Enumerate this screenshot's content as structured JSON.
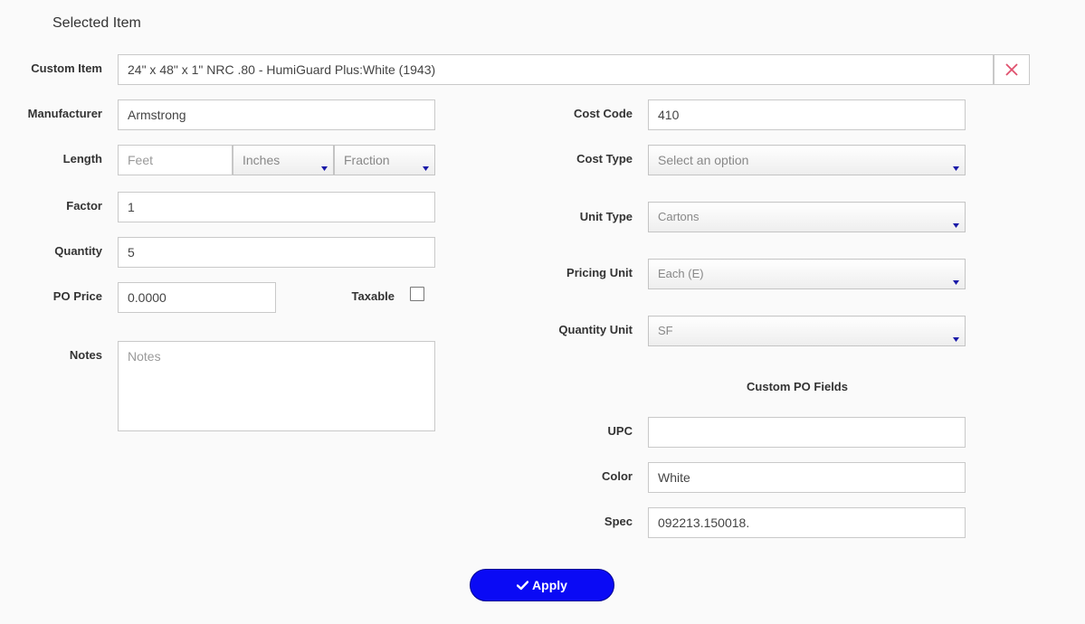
{
  "header": {
    "title": "Selected Item"
  },
  "custom_item": {
    "label": "Custom Item",
    "value": "24\" x 48\" x 1\" NRC .80 - HumiGuard Plus:White (1943)",
    "clear_icon": "close-icon",
    "clear_color": "#e0506e"
  },
  "manufacturer": {
    "label": "Manufacturer",
    "value": "Armstrong"
  },
  "length": {
    "label": "Length",
    "feet_placeholder": "Feet",
    "inches_value": "Inches",
    "fraction_value": "Fraction"
  },
  "factor": {
    "label": "Factor",
    "value": "1"
  },
  "quantity": {
    "label": "Quantity",
    "value": "5"
  },
  "po_price": {
    "label": "PO Price",
    "value": "0.0000"
  },
  "taxable": {
    "label": "Taxable",
    "checked": false
  },
  "notes": {
    "label": "Notes",
    "placeholder": "Notes"
  },
  "cost_code": {
    "label": "Cost Code",
    "value": "410"
  },
  "cost_type": {
    "label": "Cost Type",
    "value": "Select an option"
  },
  "unit_type": {
    "label": "Unit Type",
    "value": "Cartons"
  },
  "pricing_unit": {
    "label": "Pricing Unit",
    "value": "Each (E)"
  },
  "quantity_unit": {
    "label": "Quantity Unit",
    "value": "SF"
  },
  "custom_po": {
    "title": "Custom PO Fields",
    "upc": {
      "label": "UPC",
      "value": ""
    },
    "color": {
      "label": "Color",
      "value": "White"
    },
    "spec": {
      "label": "Spec",
      "value": "092213.150018."
    }
  },
  "apply_button": {
    "label": "Apply",
    "icon": "check-icon",
    "color": "#0a0af5"
  },
  "caret_color": "#1a1aa8"
}
